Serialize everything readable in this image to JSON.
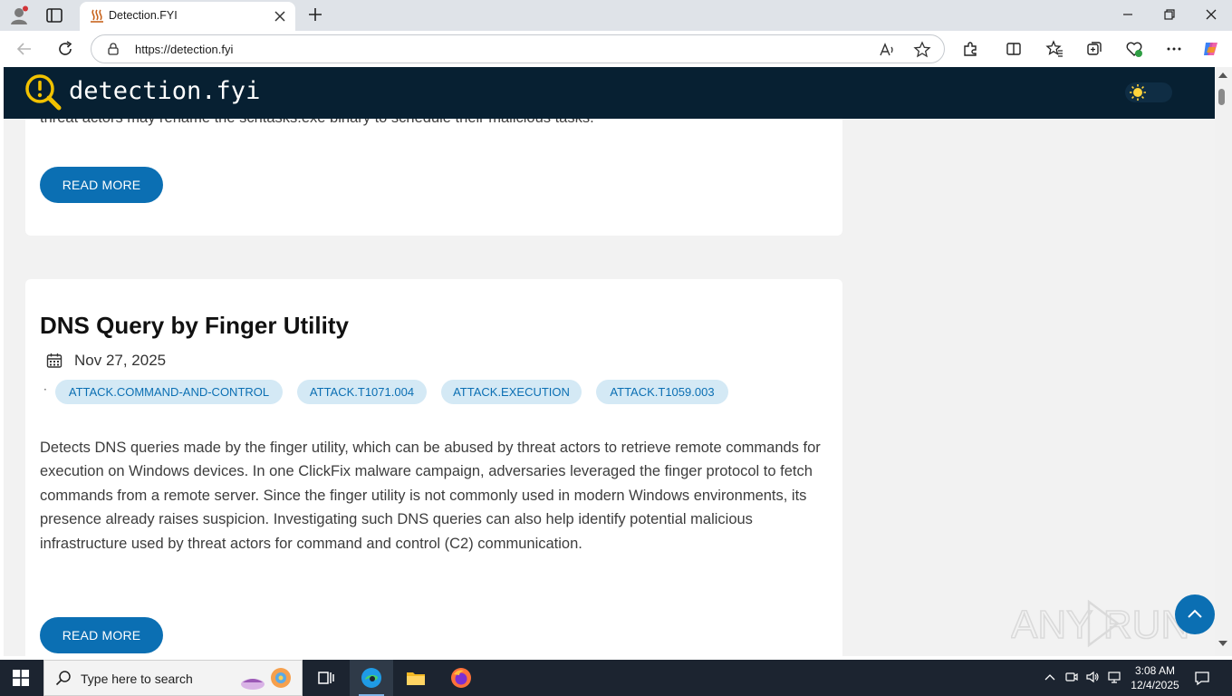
{
  "browser": {
    "tab_title": "Detection.FYI",
    "url": "https://detection.fyi"
  },
  "site": {
    "name": "detection.fyi"
  },
  "posts": [
    {
      "clipped_text": "threat actors may rename the schtasks.exe binary to schedule their malicious tasks.",
      "read_more": "READ MORE"
    },
    {
      "title": "DNS Query by Finger Utility",
      "date": "Nov 27, 2025",
      "tags": [
        "ATTACK.COMMAND-AND-CONTROL",
        "ATTACK.T1071.004",
        "ATTACK.EXECUTION",
        "ATTACK.T1059.003"
      ],
      "description": "Detects DNS queries made by the finger utility, which can be abused by threat actors to retrieve remote commands for execution on Windows devices. In one ClickFix malware campaign, adversaries leveraged the finger protocol to fetch commands from a remote server. Since the finger utility is not commonly used in modern Windows environments, its presence already raises suspicion. Investigating such DNS queries can also help identify potential malicious infrastructure used by threat actors for command and control (C2) communication.",
      "read_more": "READ MORE"
    }
  ],
  "watermark": "ANY RUN",
  "taskbar": {
    "search_placeholder": "Type here to search",
    "time": "3:08 AM",
    "date": "12/4/2025"
  },
  "colors": {
    "header_bg": "#072032",
    "accent": "#0b6fb3",
    "tag_bg": "#d4e9f5",
    "logo_yellow": "#f2c200"
  },
  "icons": [
    "profile-icon",
    "tab-actions-icon",
    "back-icon",
    "refresh-icon",
    "lock-icon",
    "read-aloud-icon",
    "favorite-star-icon",
    "extensions-icon",
    "split-screen-icon",
    "favorites-icon",
    "collections-icon",
    "performance-icon",
    "more-icon",
    "copilot-icon",
    "sun-icon",
    "calendar-icon",
    "chevron-up-icon"
  ]
}
